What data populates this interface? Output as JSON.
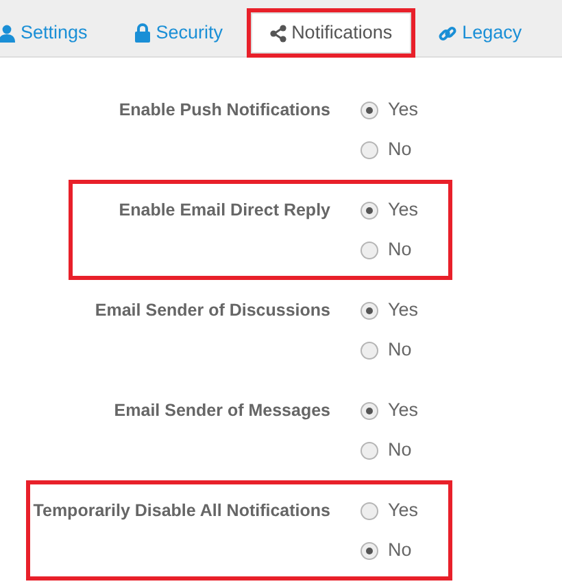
{
  "tabs": [
    {
      "label": "Settings",
      "kind": "user",
      "selected": false,
      "highlighted": false
    },
    {
      "label": "Security",
      "kind": "lock",
      "selected": false,
      "highlighted": false
    },
    {
      "label": "Notifications",
      "kind": "share",
      "selected": true,
      "highlighted": true
    },
    {
      "label": "Legacy",
      "kind": "link",
      "selected": false,
      "highlighted": false
    }
  ],
  "settings": [
    {
      "label": "Enable Push Notifications",
      "highlighted": false,
      "options": [
        {
          "label": "Yes",
          "selected": true
        },
        {
          "label": "No",
          "selected": false
        }
      ]
    },
    {
      "label": "Enable Email Direct Reply",
      "highlighted": true,
      "options": [
        {
          "label": "Yes",
          "selected": true
        },
        {
          "label": "No",
          "selected": false
        }
      ]
    },
    {
      "label": "Email Sender of Discussions",
      "highlighted": false,
      "options": [
        {
          "label": "Yes",
          "selected": true
        },
        {
          "label": "No",
          "selected": false
        }
      ]
    },
    {
      "label": "Email Sender of Messages",
      "highlighted": false,
      "options": [
        {
          "label": "Yes",
          "selected": true
        },
        {
          "label": "No",
          "selected": false
        }
      ]
    },
    {
      "label": "Temporarily Disable All Notifications",
      "highlighted": true,
      "options": [
        {
          "label": "Yes",
          "selected": false
        },
        {
          "label": "No",
          "selected": true
        }
      ]
    }
  ]
}
